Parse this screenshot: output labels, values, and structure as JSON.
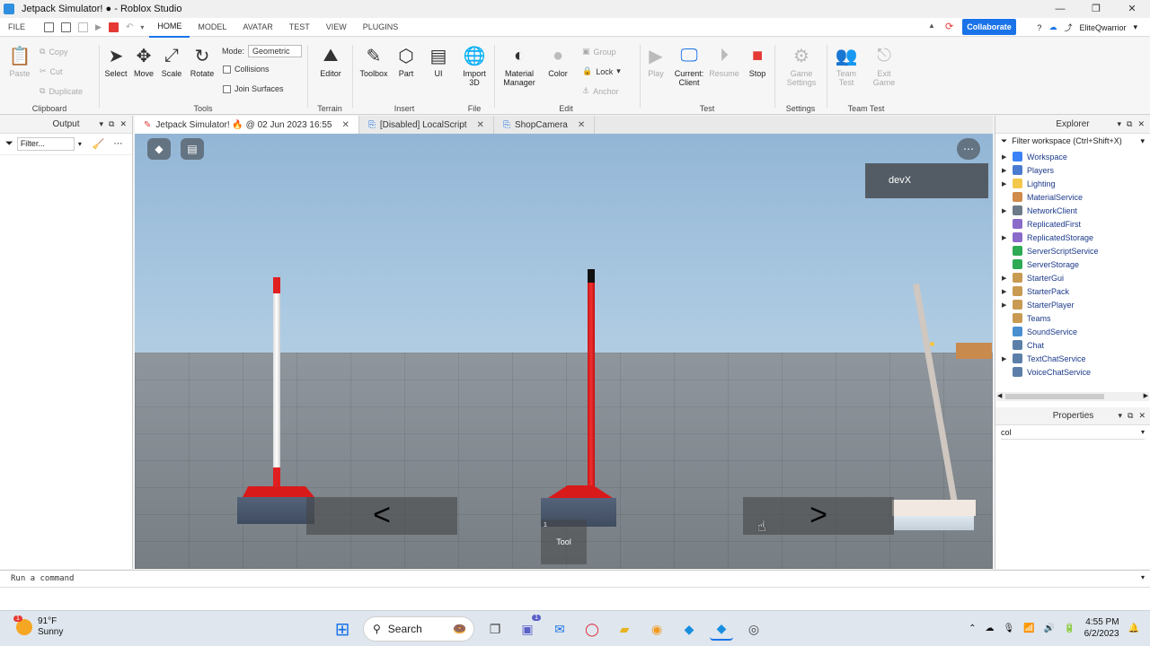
{
  "window": {
    "title": "Jetpack Simulator! ● - Roblox Studio",
    "controls": [
      "—",
      "❐",
      "✕"
    ]
  },
  "menu": {
    "file": "FILE",
    "tabs": [
      "HOME",
      "MODEL",
      "AVATAR",
      "TEST",
      "VIEW",
      "PLUGINS"
    ],
    "collaborate": "Collaborate",
    "username": "EliteQwarrior"
  },
  "ribbon": {
    "clipboard": {
      "label": "Clipboard",
      "paste": "Paste",
      "copy": "Copy",
      "cut": "Cut",
      "duplicate": "Duplicate"
    },
    "tools": {
      "label": "Tools",
      "select": "Select",
      "move": "Move",
      "scale": "Scale",
      "rotate": "Rotate",
      "mode_label": "Mode:",
      "mode_value": "Geometric",
      "collisions": "Collisions",
      "join_surfaces": "Join Surfaces"
    },
    "terrain": {
      "label": "Terrain",
      "editor": "Editor"
    },
    "insert": {
      "label": "Insert",
      "toolbox": "Toolbox",
      "part": "Part",
      "ui": "UI"
    },
    "file": {
      "label": "File",
      "import_line1": "Import",
      "import_line2": "3D"
    },
    "edit": {
      "label": "Edit",
      "material_line1": "Material",
      "material_line2": "Manager",
      "color": "Color",
      "group": "Group",
      "lock": "Lock",
      "anchor": "Anchor"
    },
    "test": {
      "label": "Test",
      "play": "Play",
      "current_line1": "Current:",
      "current_line2": "Client",
      "resume": "Resume",
      "stop": "Stop"
    },
    "settings": {
      "label": "Settings",
      "game_line1": "Game",
      "game_line2": "Settings"
    },
    "team_test": {
      "label": "Team Test",
      "team_line1": "Team",
      "team_line2": "Test",
      "exit_line1": "Exit",
      "exit_line2": "Game"
    }
  },
  "output_panel": {
    "title": "Output",
    "filter_placeholder": "Filter..."
  },
  "doc_tabs": [
    {
      "label": "Jetpack Simulator! 🔥 @ 02 Jun 2023 16:55",
      "active": true
    },
    {
      "label": "[Disabled] LocalScript",
      "active": false
    },
    {
      "label": "ShopCamera",
      "active": false
    }
  ],
  "viewport": {
    "player_name": "devX",
    "prev_arrow": "<",
    "next_arrow": ">",
    "tool_slot_number": "1",
    "tool_slot_label": "Tool"
  },
  "explorer": {
    "title": "Explorer",
    "filter_placeholder": "Filter workspace (Ctrl+Shift+X)",
    "items": [
      {
        "name": "Workspace",
        "expandable": true,
        "color": "#3b82f6"
      },
      {
        "name": "Players",
        "expandable": true,
        "color": "#4a7bd0"
      },
      {
        "name": "Lighting",
        "expandable": true,
        "color": "#f2c94c"
      },
      {
        "name": "MaterialService",
        "expandable": false,
        "color": "#d08a4a"
      },
      {
        "name": "NetworkClient",
        "expandable": true,
        "color": "#6c7a89"
      },
      {
        "name": "ReplicatedFirst",
        "expandable": false,
        "color": "#8a6bc9"
      },
      {
        "name": "ReplicatedStorage",
        "expandable": true,
        "color": "#8a6bc9"
      },
      {
        "name": "ServerScriptService",
        "expandable": false,
        "color": "#2eaa55"
      },
      {
        "name": "ServerStorage",
        "expandable": false,
        "color": "#2eaa55"
      },
      {
        "name": "StarterGui",
        "expandable": true,
        "color": "#c89a52"
      },
      {
        "name": "StarterPack",
        "expandable": true,
        "color": "#c89a52"
      },
      {
        "name": "StarterPlayer",
        "expandable": true,
        "color": "#c89a52"
      },
      {
        "name": "Teams",
        "expandable": false,
        "color": "#c89a52"
      },
      {
        "name": "SoundService",
        "expandable": false,
        "color": "#4a8fd0"
      },
      {
        "name": "Chat",
        "expandable": false,
        "color": "#5b7fa8"
      },
      {
        "name": "TextChatService",
        "expandable": true,
        "color": "#5b7fa8"
      },
      {
        "name": "VoiceChatService",
        "expandable": false,
        "color": "#5b7fa8"
      }
    ]
  },
  "properties": {
    "title": "Properties",
    "filter_value": "col"
  },
  "command_bar": {
    "placeholder": "Run a command"
  },
  "taskbar": {
    "temperature": "91°F",
    "condition": "Sunny",
    "weather_badge": "1",
    "search_label": "Search",
    "teams_badge": "1",
    "time": "4:55 PM",
    "date": "6/2/2023"
  }
}
